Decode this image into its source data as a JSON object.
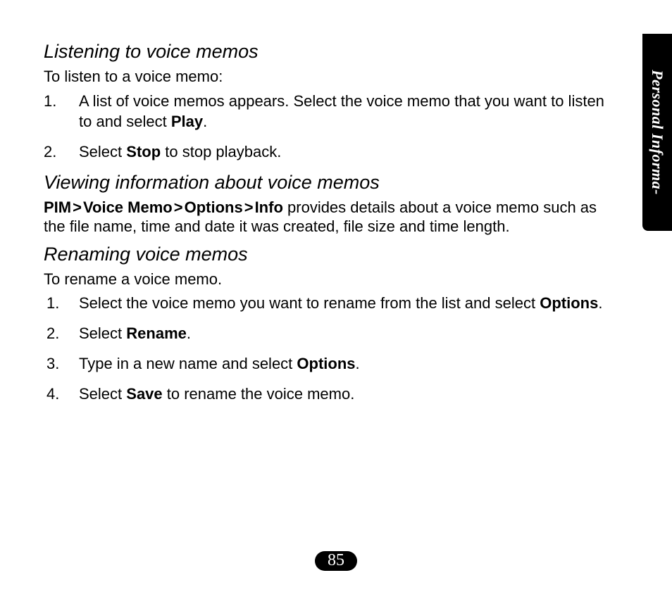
{
  "sideTab": {
    "label": "Personal Informa-"
  },
  "pageNumber": "85",
  "sections": {
    "listening": {
      "heading": "Listening to voice memos",
      "intro": "To listen to a voice memo:",
      "steps": [
        {
          "num": "1.",
          "pre": "A list of voice memos appears. Select the voice memo that you want to listen to and select ",
          "bold": "Play",
          "post": "."
        },
        {
          "num": "2.",
          "pre": " Select ",
          "bold": "Stop",
          "post": " to stop playback."
        }
      ]
    },
    "viewing": {
      "heading": "Viewing information about voice memos",
      "path": {
        "p1": "PIM",
        "sep": ">",
        "p2": "Voice Memo",
        "p3": "Options",
        "p4": "Info"
      },
      "rest": " provides details about a voice memo such as the file name, time and date it was created, file size and time length."
    },
    "renaming": {
      "heading": "Renaming voice memos",
      "intro": "To rename a voice memo.",
      "steps": [
        {
          "num": "1.",
          "pre": "Select the voice memo you want to rename from the list and select ",
          "bold": "Options",
          "post": "."
        },
        {
          "num": "2.",
          "pre": " Select ",
          "bold": "Rename",
          "post": "."
        },
        {
          "num": "3.",
          "pre": " Type in a new name and select ",
          "bold": "Options",
          "post": "."
        },
        {
          "num": "4.",
          "pre": " Select ",
          "bold": "Save",
          "post": " to rename the voice memo."
        }
      ]
    }
  }
}
